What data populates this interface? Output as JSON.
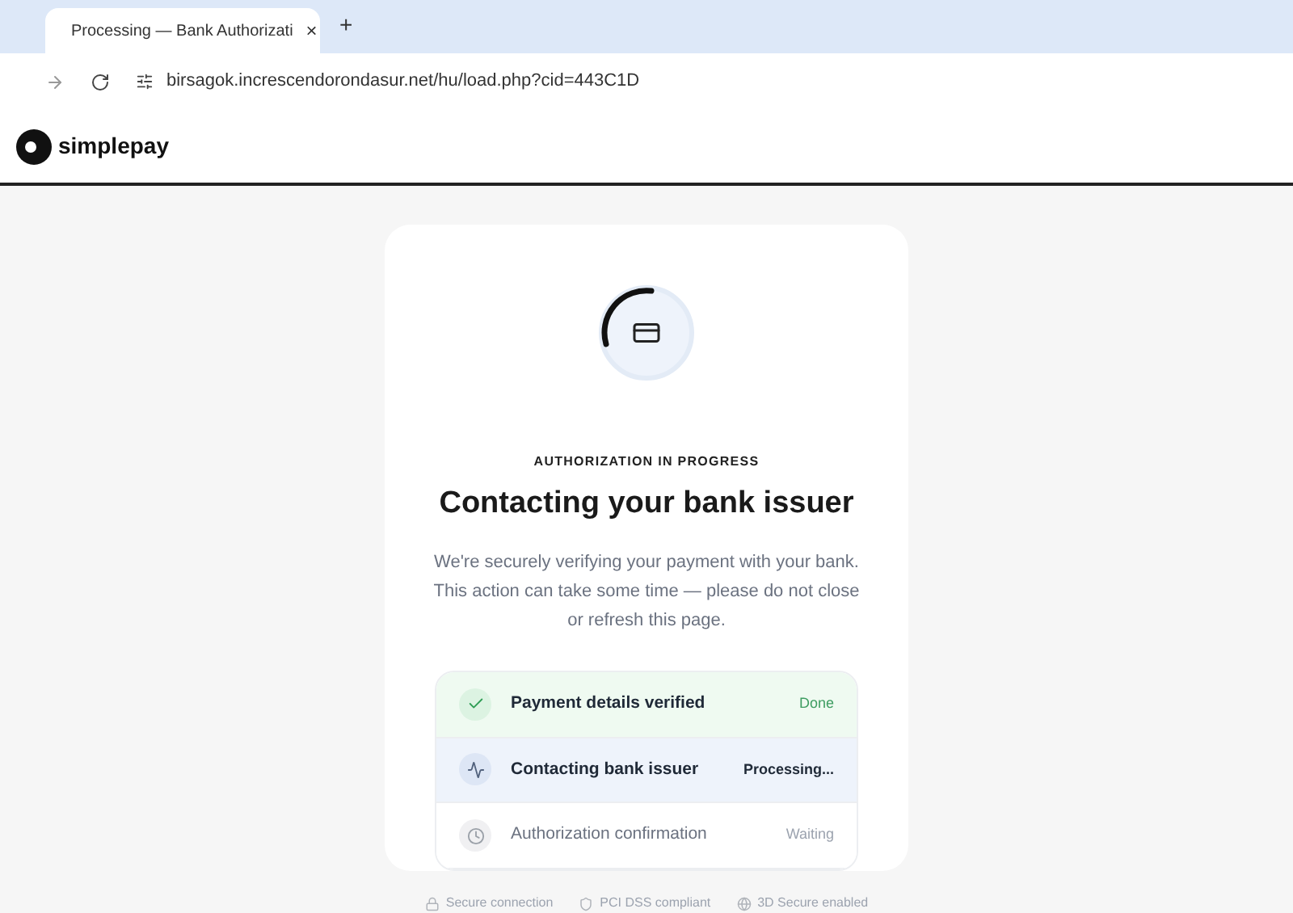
{
  "browser": {
    "tab_title": "Processing — Bank Authorizati",
    "close": "×",
    "new_tab": "+",
    "url": "birsagok.increscendorondasur.net/hu/load.php?cid=443C1D"
  },
  "header": {
    "logo_text": "simplepay"
  },
  "card": {
    "eyebrow": "AUTHORIZATION IN PROGRESS",
    "title": "Contacting your bank issuer",
    "description": "We're securely verifying your payment with your bank. This action can take some time — please do not close or refresh this page.",
    "steps": [
      {
        "kind": "done",
        "label": "Payment details verified",
        "status": "Done"
      },
      {
        "kind": "processing",
        "label": "Contacting bank issuer",
        "status": "Processing..."
      },
      {
        "kind": "waiting",
        "label": "Authorization confirmation",
        "status": "Waiting"
      }
    ]
  },
  "footer": [
    {
      "kind": "lock",
      "text": "Secure connection"
    },
    {
      "kind": "shield",
      "text": "PCI DSS compliant"
    },
    {
      "kind": "globe",
      "text": "3D Secure enabled"
    }
  ]
}
